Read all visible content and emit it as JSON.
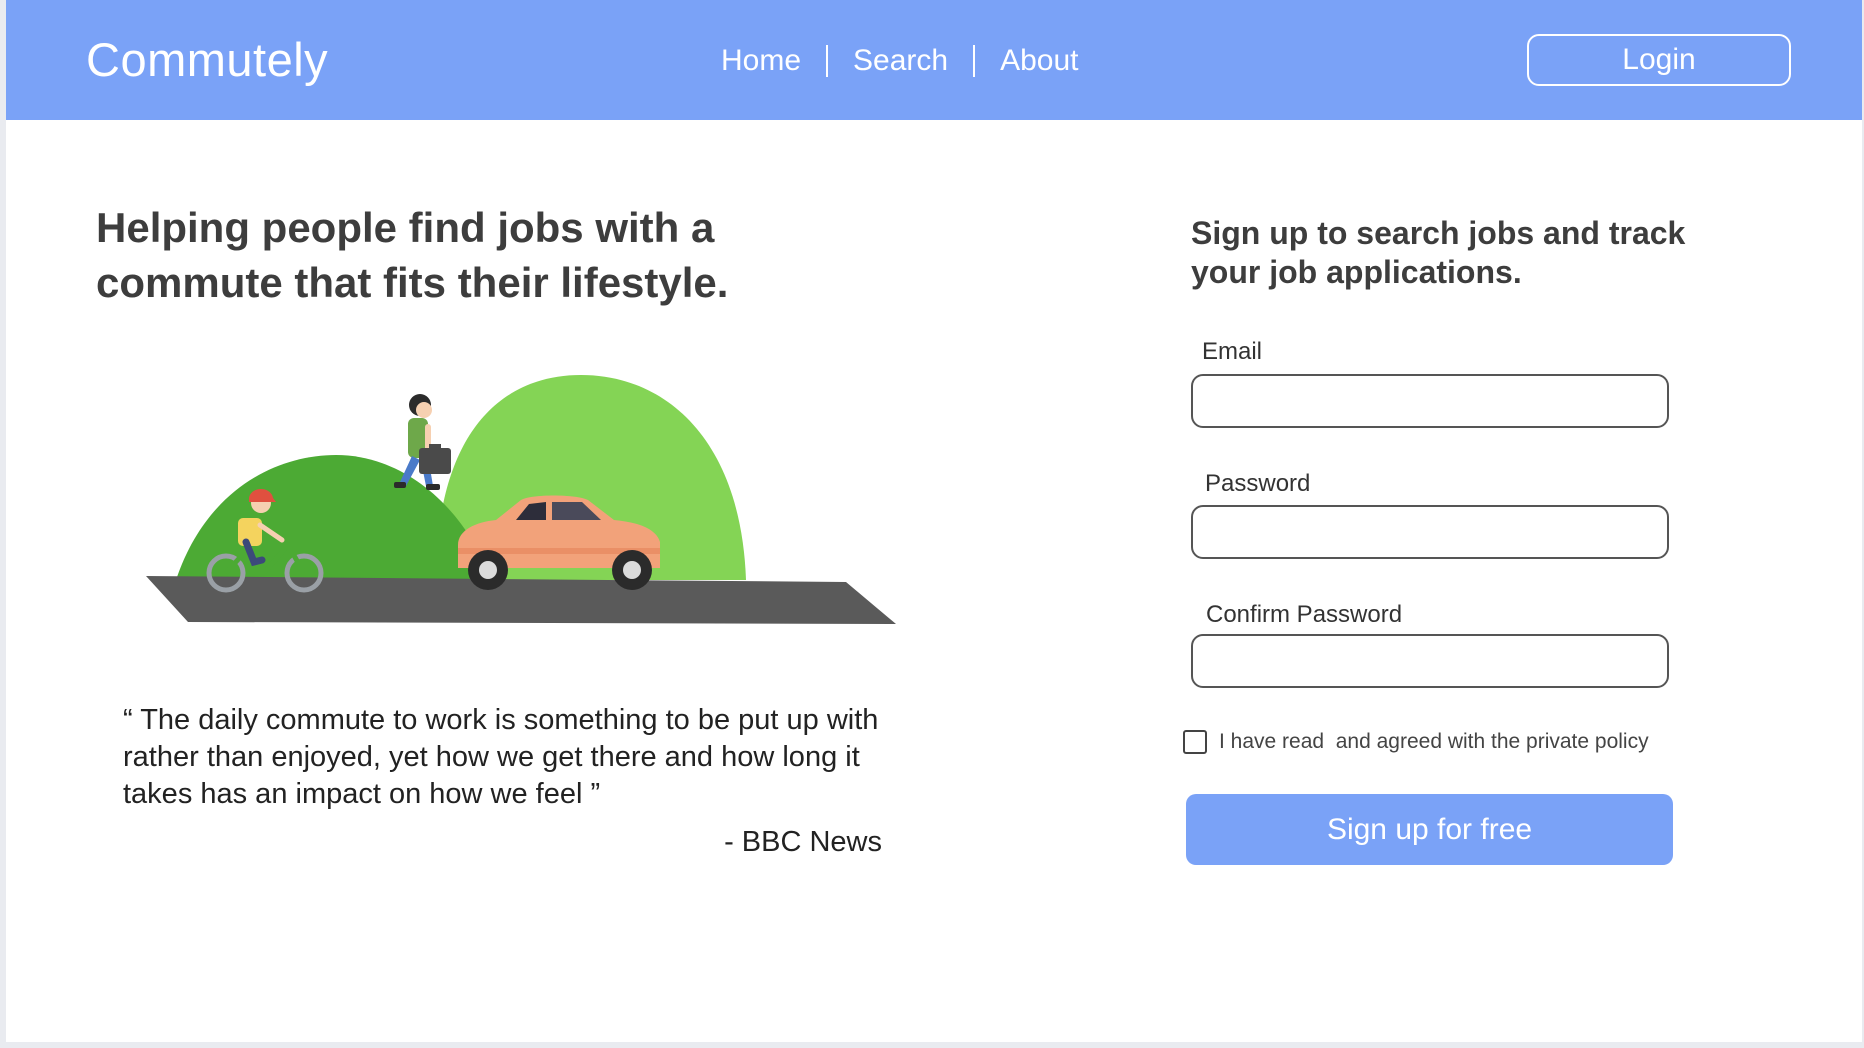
{
  "navbar": {
    "brand": "Commutely",
    "links": [
      "Home",
      "Search",
      "About"
    ],
    "login_label": "Login"
  },
  "hero": {
    "title": "Helping people find jobs with a commute that fits their lifestyle.",
    "quote": "“ The daily commute to work is something to be put up with rather than enjoyed, yet how we get there and how long it takes has an impact on how we feel ”",
    "quote_source": "- BBC News"
  },
  "signup": {
    "title": "Sign up to search jobs and track your job applications.",
    "email_label": "Email",
    "email_value": "",
    "password_label": "Password",
    "password_value": "",
    "confirm_label": "Confirm Password",
    "confirm_value": "",
    "checkbox_label": "I have read  and agreed with the private policy",
    "checkbox_checked": false,
    "submit_label": "Sign up for free"
  },
  "colors": {
    "accent": "#7aa2f7",
    "heading_text": "#3d3d3d",
    "road": "#5a5a5a",
    "hill_dark": "#4caa34",
    "hill_light": "#84d455",
    "car": "#f2a27a"
  }
}
